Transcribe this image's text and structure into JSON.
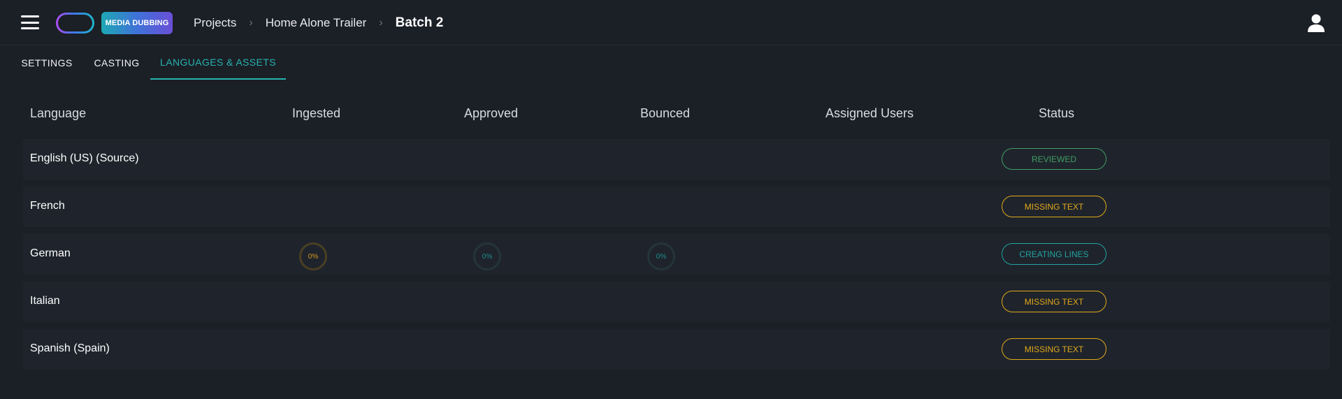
{
  "header": {
    "product_badge": "MEDIA DUBBING",
    "breadcrumb": [
      "Projects",
      "Home Alone Trailer",
      "Batch 2"
    ]
  },
  "tabs": [
    {
      "label": "SETTINGS",
      "active": false
    },
    {
      "label": "CASTING",
      "active": false
    },
    {
      "label": "LANGUAGES & ASSETS",
      "active": true
    }
  ],
  "table": {
    "columns": [
      "Language",
      "Ingested",
      "Approved",
      "Bounced",
      "Assigned Users",
      "Status"
    ],
    "rows": [
      {
        "language": "English (US) (Source)",
        "status": "REVIEWED"
      },
      {
        "language": "French",
        "status": "MISSING TEXT"
      },
      {
        "language": "German",
        "ingested": "0%",
        "approved": "0%",
        "bounced": "0%",
        "status": "CREATING LINES"
      },
      {
        "language": "Italian",
        "status": "MISSING TEXT"
      },
      {
        "language": "Spanish (Spain)",
        "status": "MISSING TEXT"
      }
    ]
  },
  "colors": {
    "accent": "#27b3b0",
    "reviewed": "#3f9e63",
    "missing": "#e0a81a",
    "creating": "#21a3a0",
    "ingested_ring": "#d49a1e"
  }
}
